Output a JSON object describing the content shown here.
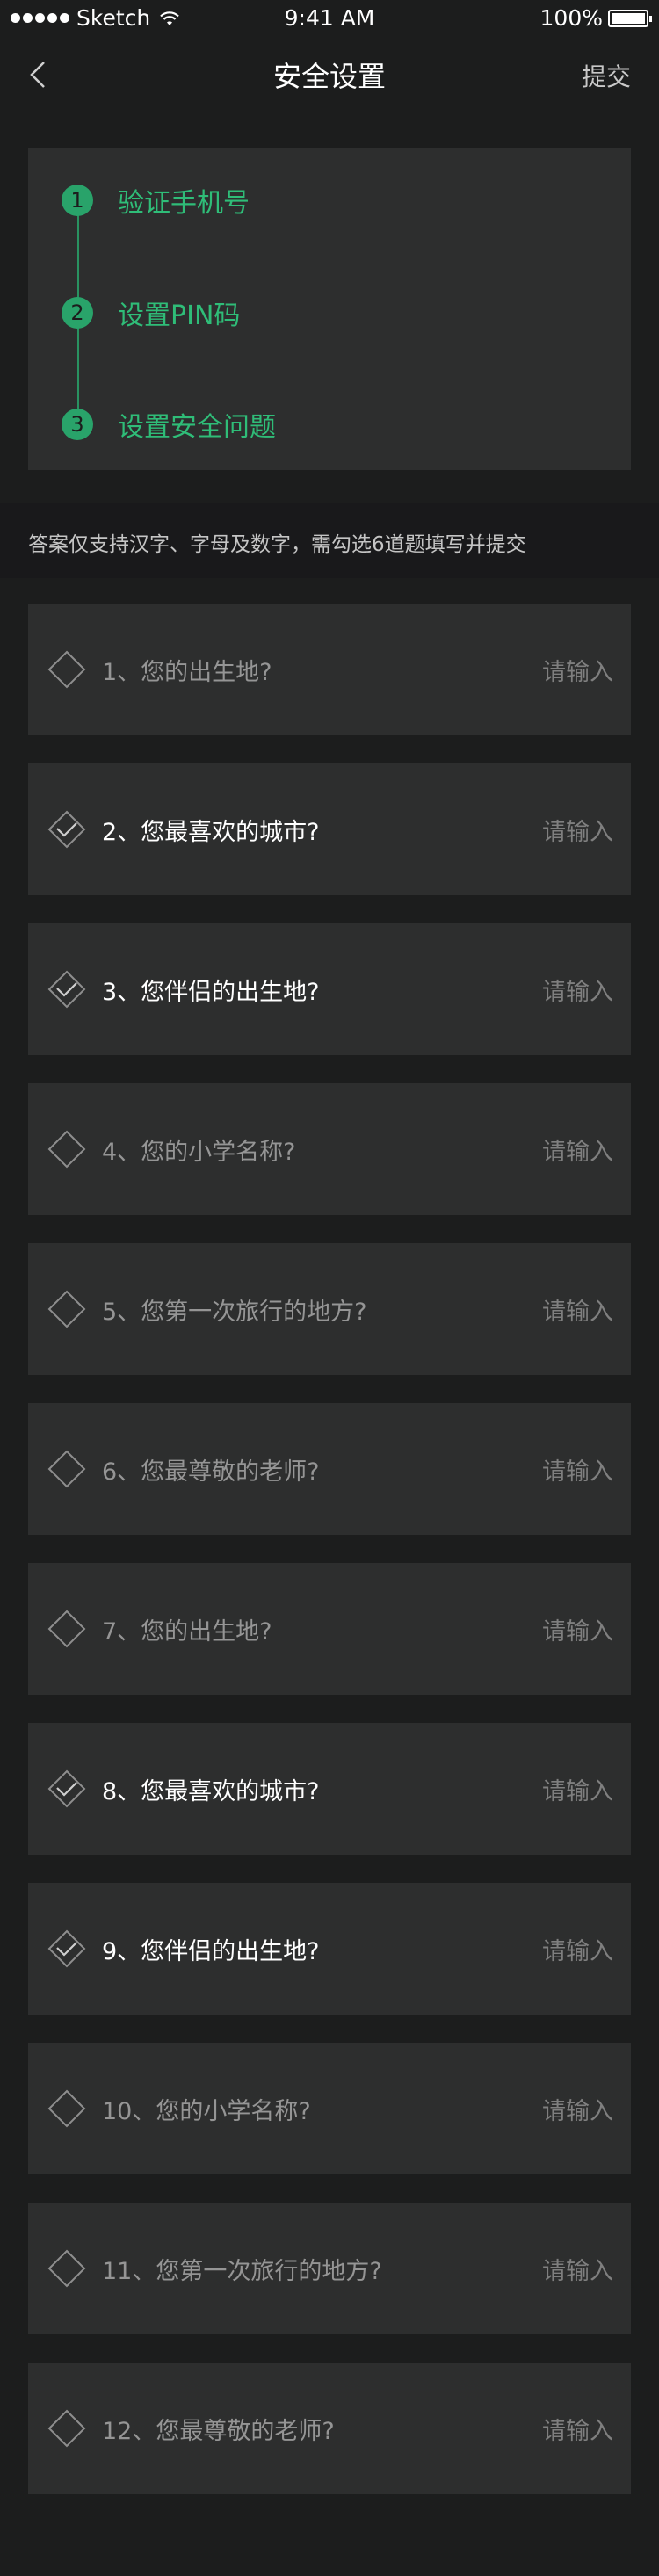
{
  "status_bar": {
    "carrier": "Sketch",
    "time": "9:41 AM",
    "battery": "100%"
  },
  "nav": {
    "title": "安全设置",
    "submit_label": "提交"
  },
  "steps": [
    {
      "number": "1",
      "label": "验证手机号"
    },
    {
      "number": "2",
      "label": "设置PIN码"
    },
    {
      "number": "3",
      "label": "设置安全问题"
    }
  ],
  "notice": "答案仅支持汉字、字母及数字，需勾选6道题填写并提交",
  "input_placeholder": "请输入",
  "questions": [
    {
      "label": "1、您的出生地?",
      "checked": false
    },
    {
      "label": "2、您最喜欢的城市?",
      "checked": true
    },
    {
      "label": "3、您伴侣的出生地?",
      "checked": true
    },
    {
      "label": "4、您的小学名称?",
      "checked": false
    },
    {
      "label": "5、您第一次旅行的地方?",
      "checked": false
    },
    {
      "label": "6、您最尊敬的老师?",
      "checked": false
    },
    {
      "label": "7、您的出生地?",
      "checked": false
    },
    {
      "label": "8、您最喜欢的城市?",
      "checked": true
    },
    {
      "label": "9、您伴侣的出生地?",
      "checked": true
    },
    {
      "label": "10、您的小学名称?",
      "checked": false
    },
    {
      "label": "11、您第一次旅行的地方?",
      "checked": false
    },
    {
      "label": "12、您最尊敬的老师?",
      "checked": false
    }
  ]
}
